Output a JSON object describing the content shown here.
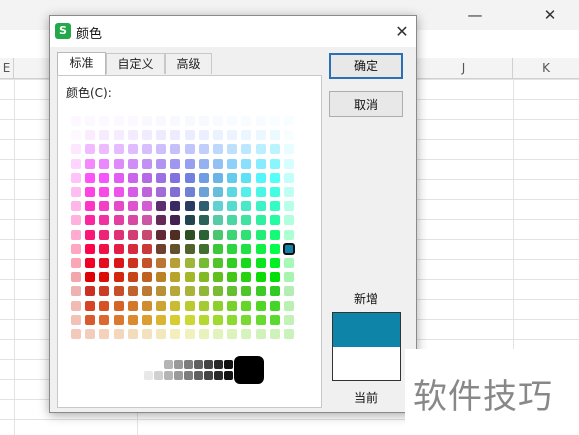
{
  "dialog": {
    "title": "颜色",
    "app_icon_letter": "S",
    "close_glyph": "✕",
    "tabs": [
      "标准",
      "自定义",
      "高级"
    ],
    "active_tab": "标准",
    "colors_label": "颜色(C):",
    "ok_label": "确定",
    "cancel_label": "取消",
    "new_label": "新增",
    "current_label": "当前",
    "new_color": "#0e84a8",
    "current_color": "#ffffff"
  },
  "spreadsheet": {
    "columns": [
      "E",
      "J",
      "K"
    ],
    "minimize_glyph": "—",
    "close_glyph": "✕"
  },
  "watermark": {
    "text": "软件技巧"
  },
  "accent_color": "#2b6fb6",
  "palette": {
    "selected": {
      "row": 9,
      "col": 15
    },
    "grays": [
      "#e8e8e8",
      "#d0d0d0",
      "#b5b5b5",
      "#9a9a9a",
      "#7d7d7d",
      "#606060",
      "#444444",
      "#2a2a2a",
      "#111111"
    ]
  }
}
